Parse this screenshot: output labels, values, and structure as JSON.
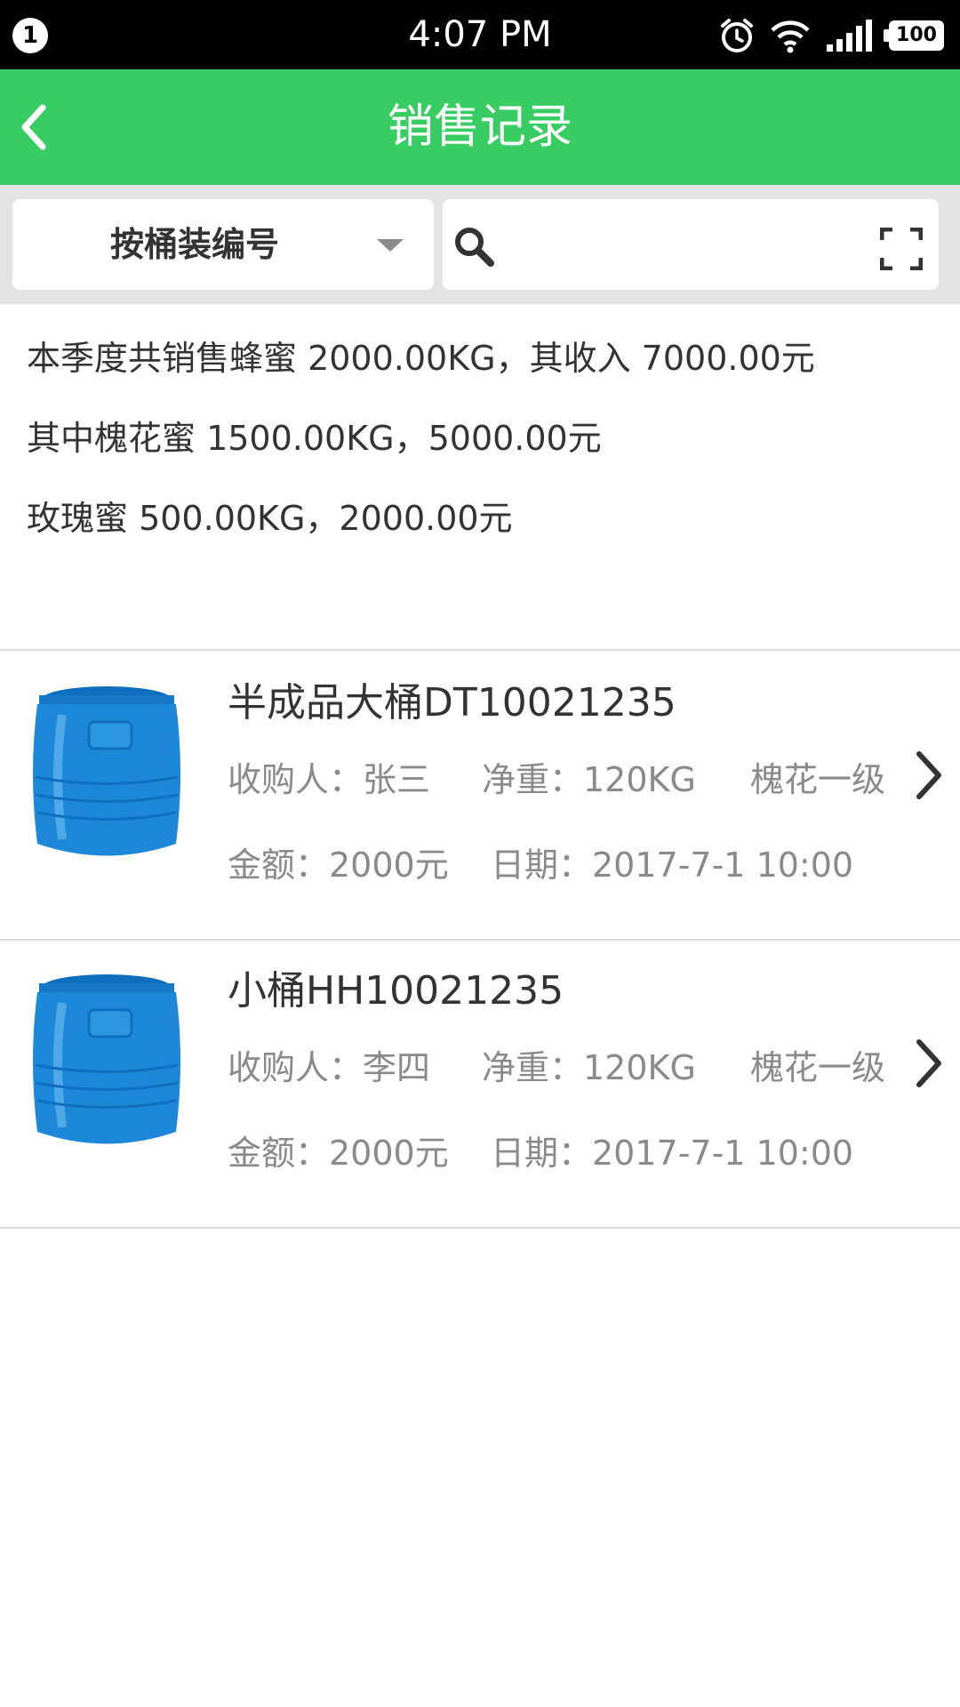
{
  "status_bar": {
    "notification_count": "1",
    "time": "4:07 PM",
    "battery": "100"
  },
  "header": {
    "title": "销售记录"
  },
  "filter": {
    "select_label": "按桶装编号",
    "search_placeholder": ""
  },
  "summary": {
    "lines": [
      "本季度共销售蜂蜜 2000.00KG，其收入 7000.00元",
      "其中槐花蜜 1500.00KG，5000.00元",
      "玫瑰蜜 500.00KG，2000.00元"
    ]
  },
  "records": [
    {
      "title": "半成品大桶DT10021235",
      "buyer": "收购人：张三",
      "weight": "净重：120KG",
      "grade": "槐花一级",
      "amount": "金额：2000元",
      "date": "日期：2017-7-1 10:00"
    },
    {
      "title": "小桶HH10021235",
      "buyer": "收购人：李四",
      "weight": "净重：120KG",
      "grade": "槐花一级",
      "amount": "金额：2000元",
      "date": "日期：2017-7-1 10:00"
    }
  ],
  "colors": {
    "accent": "#37cd62",
    "barrel_blue": "#1e88d8"
  }
}
